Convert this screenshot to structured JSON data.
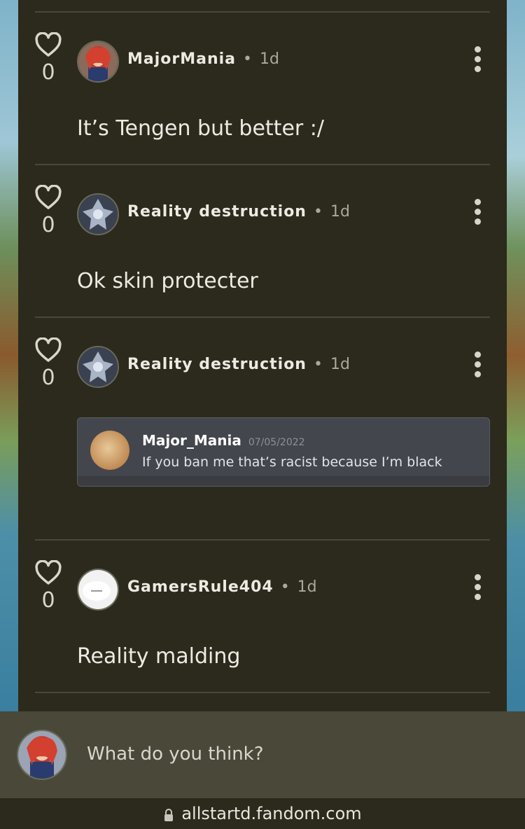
{
  "comments": [
    {
      "author": "MajorMania",
      "time": "1d",
      "likes": "0",
      "text": "It’s Tengen but better :/"
    },
    {
      "author": "Reality destruction",
      "time": "1d",
      "likes": "0",
      "text": "Ok skin protecter"
    },
    {
      "author": "Reality destruction",
      "time": "1d",
      "likes": "0",
      "embed": {
        "name": "Major_Mania",
        "date": "07/05/2022",
        "message": "If you ban me that’s racist because I’m black"
      }
    },
    {
      "author": "GamersRule404",
      "time": "1d",
      "likes": "0",
      "text": "Reality malding"
    }
  ],
  "composer": {
    "placeholder": "What do you think?"
  },
  "browser": {
    "url": "allstartd.fandom.com"
  },
  "colors": {
    "panel": "#2c2a1c",
    "divider": "#4a4938",
    "text": "#ecebe2",
    "muted": "#aaa99c"
  },
  "icons": [
    "heart-icon",
    "more-vertical-icon",
    "lock-icon"
  ],
  "separator": "•"
}
